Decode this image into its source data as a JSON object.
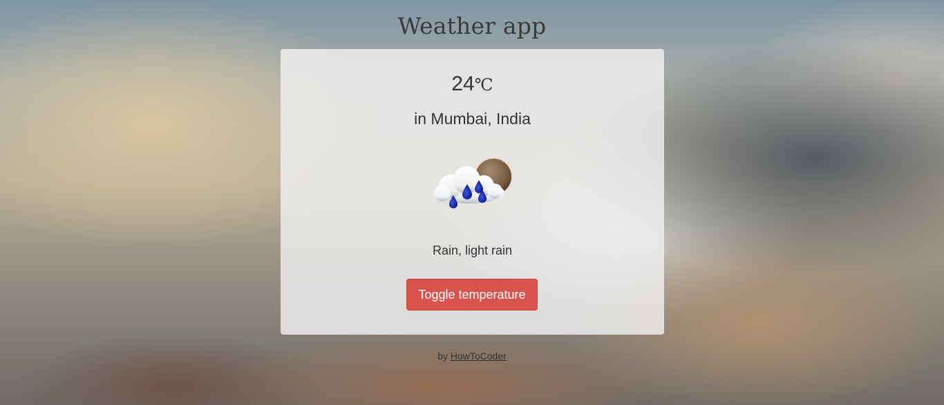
{
  "app": {
    "title": "Weather app"
  },
  "weather": {
    "temperature": "24",
    "unit": "℃",
    "location": "in Mumbai, India",
    "description": "Rain, light rain",
    "icon": "rain-cloud-moon-icon"
  },
  "controls": {
    "toggle_label": "Toggle temperature"
  },
  "footer": {
    "by_text": "by",
    "link_text": "HowToCoder"
  },
  "colors": {
    "button_bg": "#d9534f",
    "card_bg": "rgba(240,240,240,0.82)",
    "text": "#333333"
  }
}
